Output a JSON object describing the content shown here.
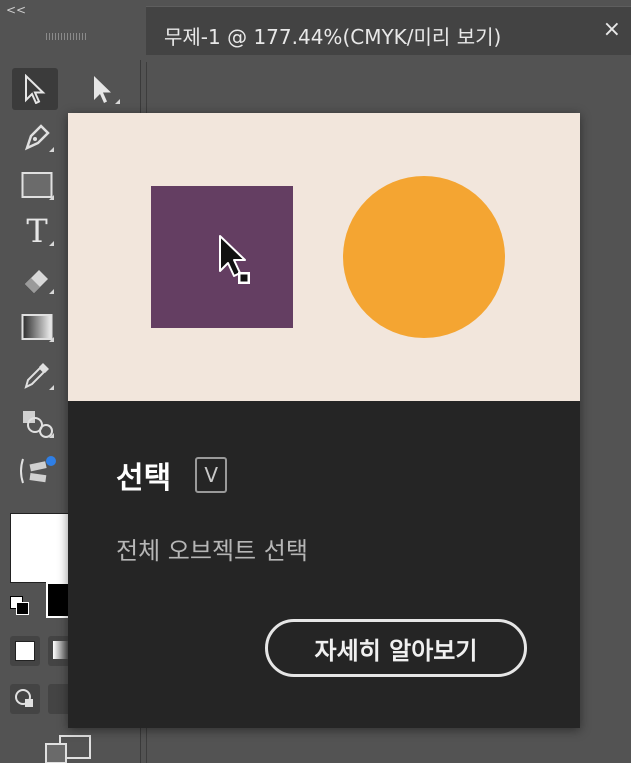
{
  "panel": {
    "collapse_label": "<<"
  },
  "tools": [
    {
      "name": "selection-tool",
      "icon": "selection-arrow-icon"
    },
    {
      "name": "direct-selection-tool",
      "icon": "direct-selection-arrow-icon"
    },
    {
      "name": "pen-tool",
      "icon": "pen-icon"
    },
    {
      "name": "rectangle-tool",
      "icon": "rectangle-icon"
    },
    {
      "name": "type-tool",
      "icon": "type-icon"
    },
    {
      "name": "eraser-tool",
      "icon": "eraser-icon"
    },
    {
      "name": "gradient-tool",
      "icon": "gradient-icon"
    },
    {
      "name": "eyedropper-tool",
      "icon": "eyedropper-icon"
    },
    {
      "name": "shape-builder-tool",
      "icon": "shape-builder-icon"
    },
    {
      "name": "blend-tool",
      "icon": "blend-icon"
    }
  ],
  "type_tool_glyph": "T",
  "document_tab": {
    "title": "무제-1 @ 177.44%(CMYK/미리 보기)",
    "close_label": "×"
  },
  "tooltip": {
    "title": "선택",
    "shortcut": "V",
    "description": "전체 오브젝트 선택",
    "learn_more": "자세히 알아보기",
    "colors": {
      "background": "#f2e6dc",
      "square": "#643e62",
      "circle": "#f4a532"
    }
  }
}
